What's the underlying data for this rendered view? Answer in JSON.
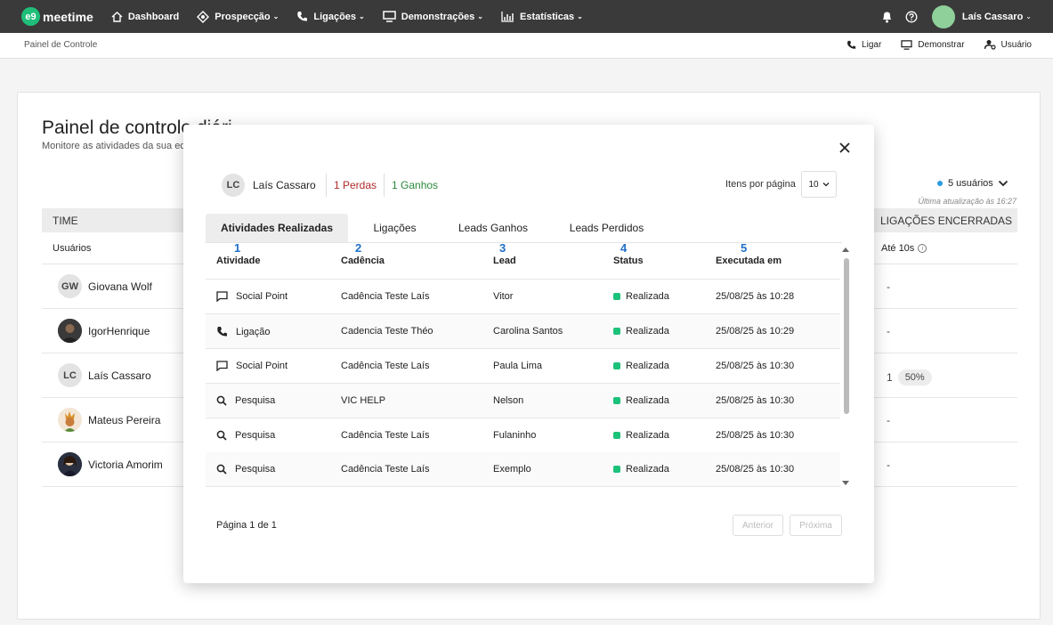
{
  "nav": {
    "logo_badge": "e9",
    "logo_text": "meetime",
    "items": [
      {
        "label": "Dashboard",
        "icon": "home-icon"
      },
      {
        "label": "Prospecção",
        "icon": "target-icon",
        "caret": true
      },
      {
        "label": "Ligações",
        "icon": "phone-icon",
        "caret": true
      },
      {
        "label": "Demonstrações",
        "icon": "monitor-icon",
        "caret": true
      },
      {
        "label": "Estatísticas",
        "icon": "chart-icon",
        "caret": true
      }
    ],
    "user_name": "Laís Cassaro",
    "caret": "⌄"
  },
  "subbar": {
    "breadcrumb": "Painel de Controle",
    "actions": [
      {
        "label": "Ligar",
        "icon": "phone-icon"
      },
      {
        "label": "Demonstrar",
        "icon": "monitor-icon"
      },
      {
        "label": "Usuário",
        "icon": "user-icon"
      }
    ]
  },
  "page": {
    "title": "Painel de controle diári",
    "subtitle": "Monitore as atividades da sua eq",
    "users_selector": "5 usuários",
    "last_update": "Última atualização às 16:27",
    "col_team": "TIME",
    "col_calls": "LIGAÇÕES ENCERRADAS",
    "sub_users": "Usuários",
    "sub_10s": "Até 10s",
    "users": [
      {
        "initials": "GW",
        "name": "Giovana Wolf",
        "value": "-",
        "pct": ""
      },
      {
        "initials": "",
        "name": "IgorHenrique",
        "value": "-",
        "pct": ""
      },
      {
        "initials": "LC",
        "name": "Laís Cassaro",
        "value": "1",
        "pct": "50%"
      },
      {
        "initials": "",
        "name": "Mateus Pereira",
        "value": "-",
        "pct": ""
      },
      {
        "initials": "",
        "name": "Victoria Amorim",
        "value": "-",
        "pct": ""
      }
    ]
  },
  "modal": {
    "user_initials": "LC",
    "user_name": "Laís Cassaro",
    "losses": "1 Perdas",
    "gains": "1 Ganhos",
    "items_per_page_label": "Itens por página",
    "items_per_page": "10",
    "tabs": [
      "Atividades Realizadas",
      "Ligações",
      "Leads Ganhos",
      "Leads Perdidos"
    ],
    "columns": [
      {
        "num": "1",
        "label": "Atividade"
      },
      {
        "num": "2",
        "label": "Cadência"
      },
      {
        "num": "3",
        "label": "Lead"
      },
      {
        "num": "4",
        "label": "Status"
      },
      {
        "num": "5",
        "label": "Executada em"
      }
    ],
    "rows": [
      {
        "icon": "chat-icon",
        "activity": "Social Point",
        "cadence": "Cadência Teste Laís",
        "lead": "Vitor",
        "status": "Realizada",
        "executed": "25/08/25 às 10:28"
      },
      {
        "icon": "phone-icon",
        "activity": "Ligação",
        "cadence": "Cadencia Teste Théo",
        "lead": "Carolina Santos",
        "status": "Realizada",
        "executed": "25/08/25 às 10:29"
      },
      {
        "icon": "chat-icon",
        "activity": "Social Point",
        "cadence": "Cadência Teste Laís",
        "lead": "Paula Lima",
        "status": "Realizada",
        "executed": "25/08/25 às 10:30"
      },
      {
        "icon": "search-icon",
        "activity": "Pesquisa",
        "cadence": "VIC HELP",
        "lead": "Nelson",
        "status": "Realizada",
        "executed": "25/08/25 às 10:30"
      },
      {
        "icon": "search-icon",
        "activity": "Pesquisa",
        "cadence": "Cadência Teste Laís",
        "lead": "Fulaninho",
        "status": "Realizada",
        "executed": "25/08/25 às 10:30"
      },
      {
        "icon": "search-icon",
        "activity": "Pesquisa",
        "cadence": "Cadência Teste Laís",
        "lead": "Exemplo",
        "status": "Realizada",
        "executed": "25/08/25 às 10:30"
      }
    ],
    "page_info": "Página 1 de 1",
    "prev": "Anterior",
    "next": "Próxima"
  },
  "colors": {
    "accent": "#1fbf7a",
    "loss": "#b02a2a",
    "gain": "#2a8a3a",
    "status": "#1cc27a",
    "column_number": "#1f6fc9"
  }
}
